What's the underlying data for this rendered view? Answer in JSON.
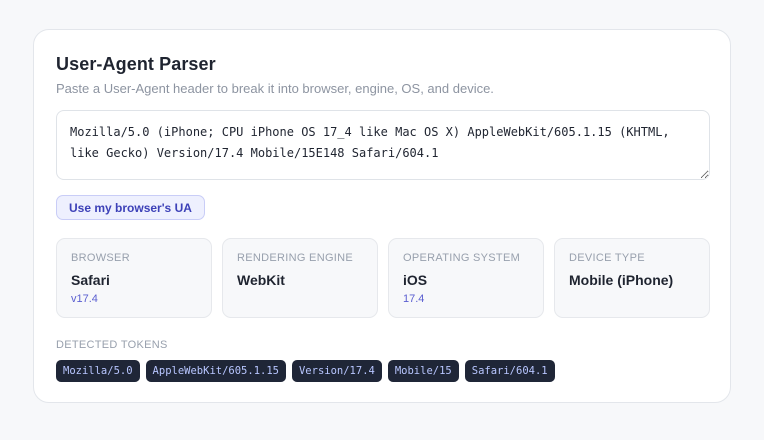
{
  "header": {
    "title": "User-Agent Parser",
    "subtitle": "Paste a User-Agent header to break it into browser, engine, OS, and device."
  },
  "input": {
    "value": "Mozilla/5.0 (iPhone; CPU iPhone OS 17_4 like Mac OS X) AppleWebKit/605.1.15 (KHTML, like Gecko) Version/17.4 Mobile/15E148 Safari/604.1"
  },
  "use_ua_button": {
    "label": "Use my browser's UA"
  },
  "results": [
    {
      "label": "BROWSER",
      "value": "Safari",
      "version": "v17.4"
    },
    {
      "label": "RENDERING ENGINE",
      "value": "WebKit",
      "version": ""
    },
    {
      "label": "OPERATING SYSTEM",
      "value": "iOS",
      "version": "17.4"
    },
    {
      "label": "DEVICE TYPE",
      "value": "Mobile (iPhone)",
      "version": ""
    }
  ],
  "tokens": {
    "label": "DETECTED TOKENS",
    "items": [
      "Mozilla/5.0",
      "AppleWebKit/605.1.15",
      "Version/17.4",
      "Mobile/15",
      "Safari/604.1"
    ]
  },
  "colors": {
    "accent": "#3d41b8",
    "version_text": "#5a5ed0",
    "token_bg": "#1f2637",
    "token_text": "#b8c6ff"
  }
}
